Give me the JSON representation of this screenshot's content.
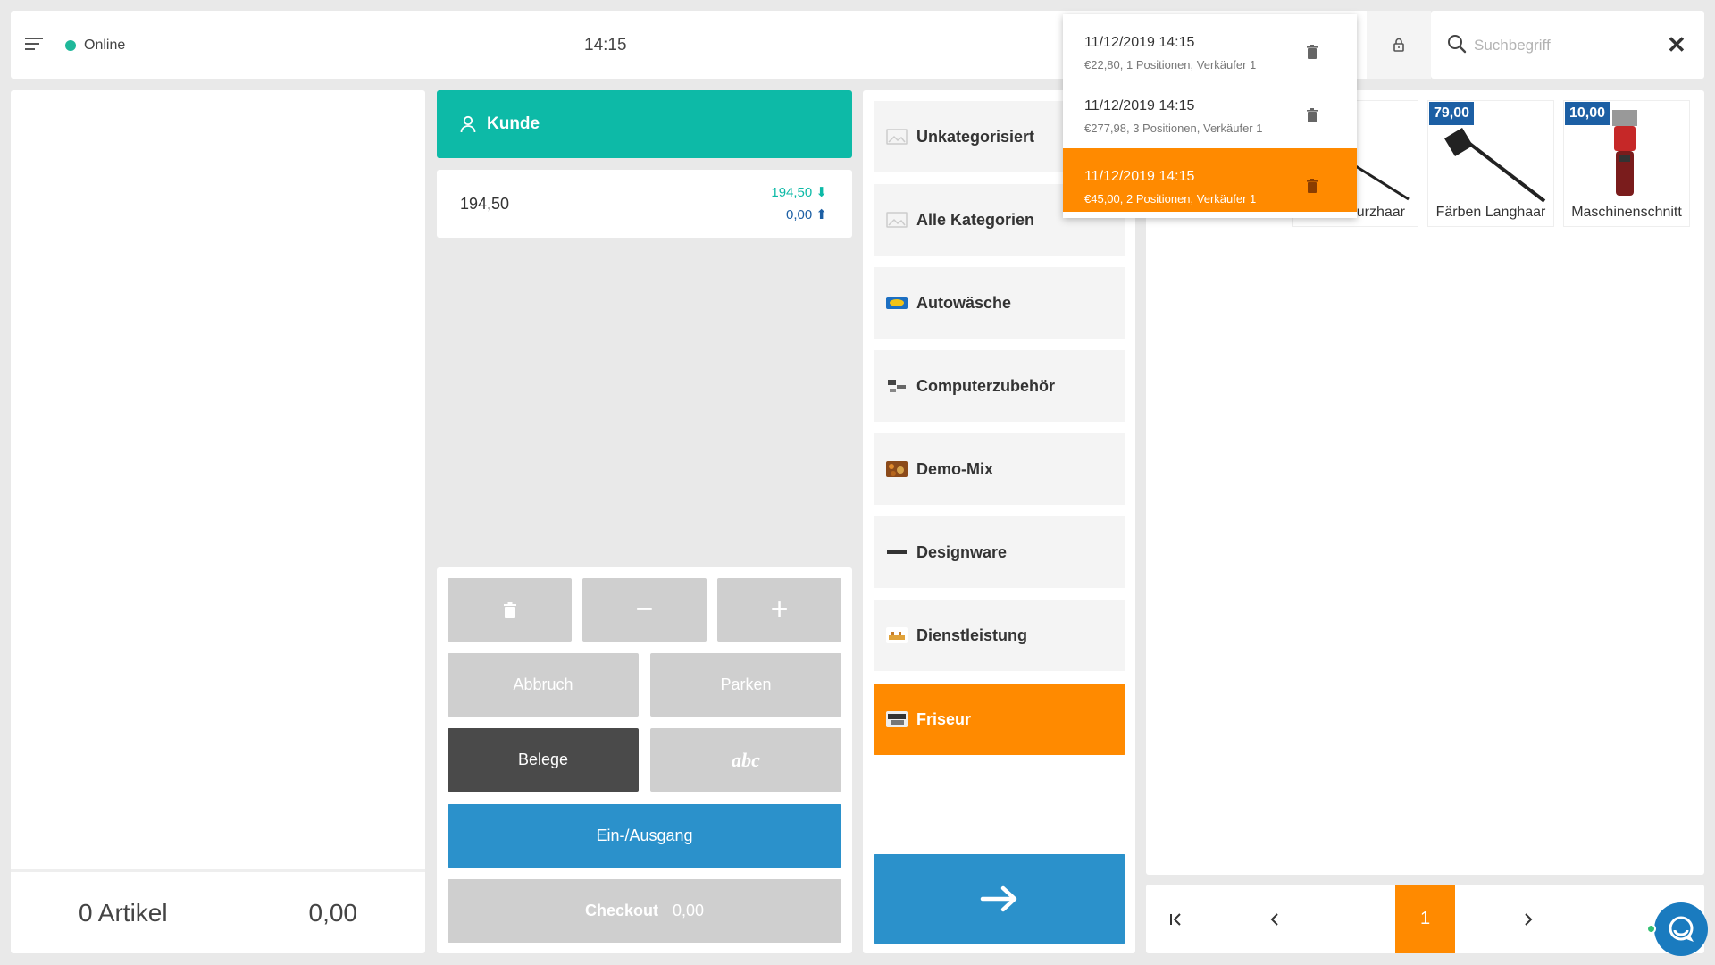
{
  "topbar": {
    "status": "Online",
    "time": "14:15"
  },
  "search": {
    "placeholder": "Suchbegriff",
    "value": ""
  },
  "cart": {
    "count_label": "0 Artikel",
    "total": "0,00"
  },
  "customer": {
    "label": "Kunde"
  },
  "amount": {
    "main": "194,50",
    "incoming": "194,50",
    "outgoing": "0,00"
  },
  "keypad": {
    "minus": "−",
    "plus": "+",
    "abbruch": "Abbruch",
    "parken": "Parken",
    "belege": "Belege",
    "abc": "abc",
    "ein_ausgang": "Ein-/Ausgang",
    "checkout_label": "Checkout",
    "checkout_amount": "0,00"
  },
  "categories": [
    {
      "label": "Unkategorisiert",
      "icon": "image-placeholder-icon",
      "active": false
    },
    {
      "label": "Alle Kategorien",
      "icon": "image-placeholder-icon",
      "active": false
    },
    {
      "label": "Autowäsche",
      "icon": "car-wash-icon",
      "active": false
    },
    {
      "label": "Computerzubehör",
      "icon": "computer-accessories-icon",
      "active": false
    },
    {
      "label": "Demo-Mix",
      "icon": "demo-mix-icon",
      "active": false
    },
    {
      "label": "Designware",
      "icon": "designer-logo-icon",
      "active": false
    },
    {
      "label": "Dienstleistung",
      "icon": "service-icon",
      "active": false
    },
    {
      "label": "Friseur",
      "icon": "hairdresser-icon",
      "active": true
    }
  ],
  "products": [
    {
      "name": "urzhaar",
      "price": ""
    },
    {
      "name": "Färben Langhaar",
      "price": "79,00"
    },
    {
      "name": "Maschinenschnitt",
      "price": "10,00"
    }
  ],
  "pager": {
    "current": "1"
  },
  "receipts": [
    {
      "date": "11/12/2019 14:15",
      "info": "€22,80, 1 Positionen, Verkäufer 1",
      "active": false
    },
    {
      "date": "11/12/2019 14:15",
      "info": "€277,98, 3 Positionen, Verkäufer 1",
      "active": false
    },
    {
      "date": "11/12/2019 14:15",
      "info": "€45,00, 2 Positionen, Verkäufer 1",
      "active": true
    }
  ],
  "colors": {
    "teal": "#0dbaa7",
    "orange": "#ff8a00",
    "blue": "#2b91cb",
    "navy": "#1c5fa4",
    "dark": "#4a4a4a"
  }
}
